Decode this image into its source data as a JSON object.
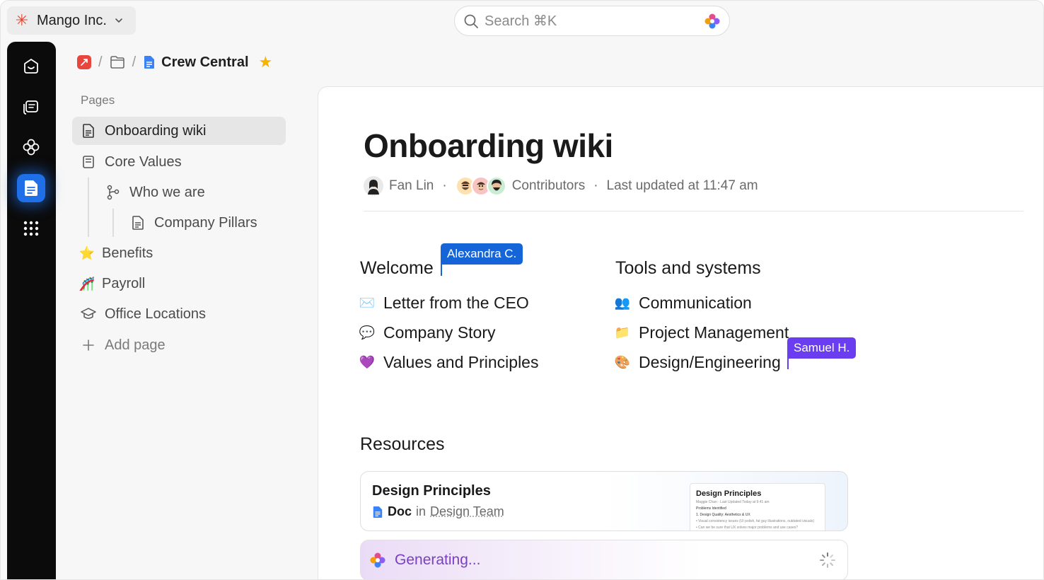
{
  "workspace": {
    "name": "Mango Inc."
  },
  "search": {
    "placeholder": "Search ⌘K"
  },
  "rail": {
    "items": [
      "home-icon",
      "chat-icon",
      "ai-brain-icon",
      "docs-icon",
      "apps-grid-icon"
    ],
    "active": "docs-icon"
  },
  "breadcrumb": {
    "title": "Crew Central"
  },
  "sidebar": {
    "section_label": "Pages",
    "items": [
      {
        "label": "Onboarding wiki",
        "icon": "document-icon"
      },
      {
        "label": "Core Values",
        "icon": "book-icon"
      },
      {
        "label": "Who we are",
        "icon": "branch-icon"
      },
      {
        "label": "Company Pillars",
        "icon": "document-icon"
      },
      {
        "label": "Benefits",
        "icon": "⭐"
      },
      {
        "label": "Payroll",
        "icon": "🎢"
      },
      {
        "label": "Office Locations",
        "icon": "graduation-cap-icon"
      },
      {
        "label": "Add page",
        "icon": "plus-icon"
      }
    ]
  },
  "page": {
    "title": "Onboarding wiki",
    "author": "Fan Lin",
    "contributors_label": "Contributors",
    "updated": "Last updated at 11:47 am",
    "separator": "·"
  },
  "welcome": {
    "title": "Welcome",
    "items": [
      {
        "emoji": "✉️",
        "label": "Letter from the CEO"
      },
      {
        "emoji": "💬",
        "label": "Company Story"
      },
      {
        "emoji": "💜",
        "label": "Values and Principles"
      }
    ]
  },
  "tools": {
    "title": "Tools and systems",
    "items": [
      {
        "emoji": "👥",
        "label": "Communication"
      },
      {
        "emoji": "📁",
        "label": "Project Management"
      },
      {
        "emoji": "🎨",
        "label": "Design/Engineering"
      }
    ]
  },
  "cursors": [
    {
      "name": "Alexandra C.",
      "color": "#1565d8"
    },
    {
      "name": "Samuel H.",
      "color": "#6a3df0"
    }
  ],
  "resources": {
    "title": "Resources",
    "card": {
      "title": "Design Principles",
      "type": "Doc",
      "in_word": "in",
      "team": "Design Team",
      "preview": {
        "title": "Design Principles",
        "byline": "Maggie Chan · Last Updated Today at 9:41 am",
        "heading": "Problems Identified",
        "line1": "1. Design Quality: Aesthetics & UX",
        "line2": "• Visual consistency issues (UI polish, fat guy illustrations, outdated visuals)",
        "line3": "• Can we be sure that UX solves major problems and use cases?"
      }
    },
    "generating": "Generating..."
  },
  "colors": {
    "accent": "#1e6fe8",
    "generate": "#7a3fc4",
    "star": "#f5b400"
  }
}
